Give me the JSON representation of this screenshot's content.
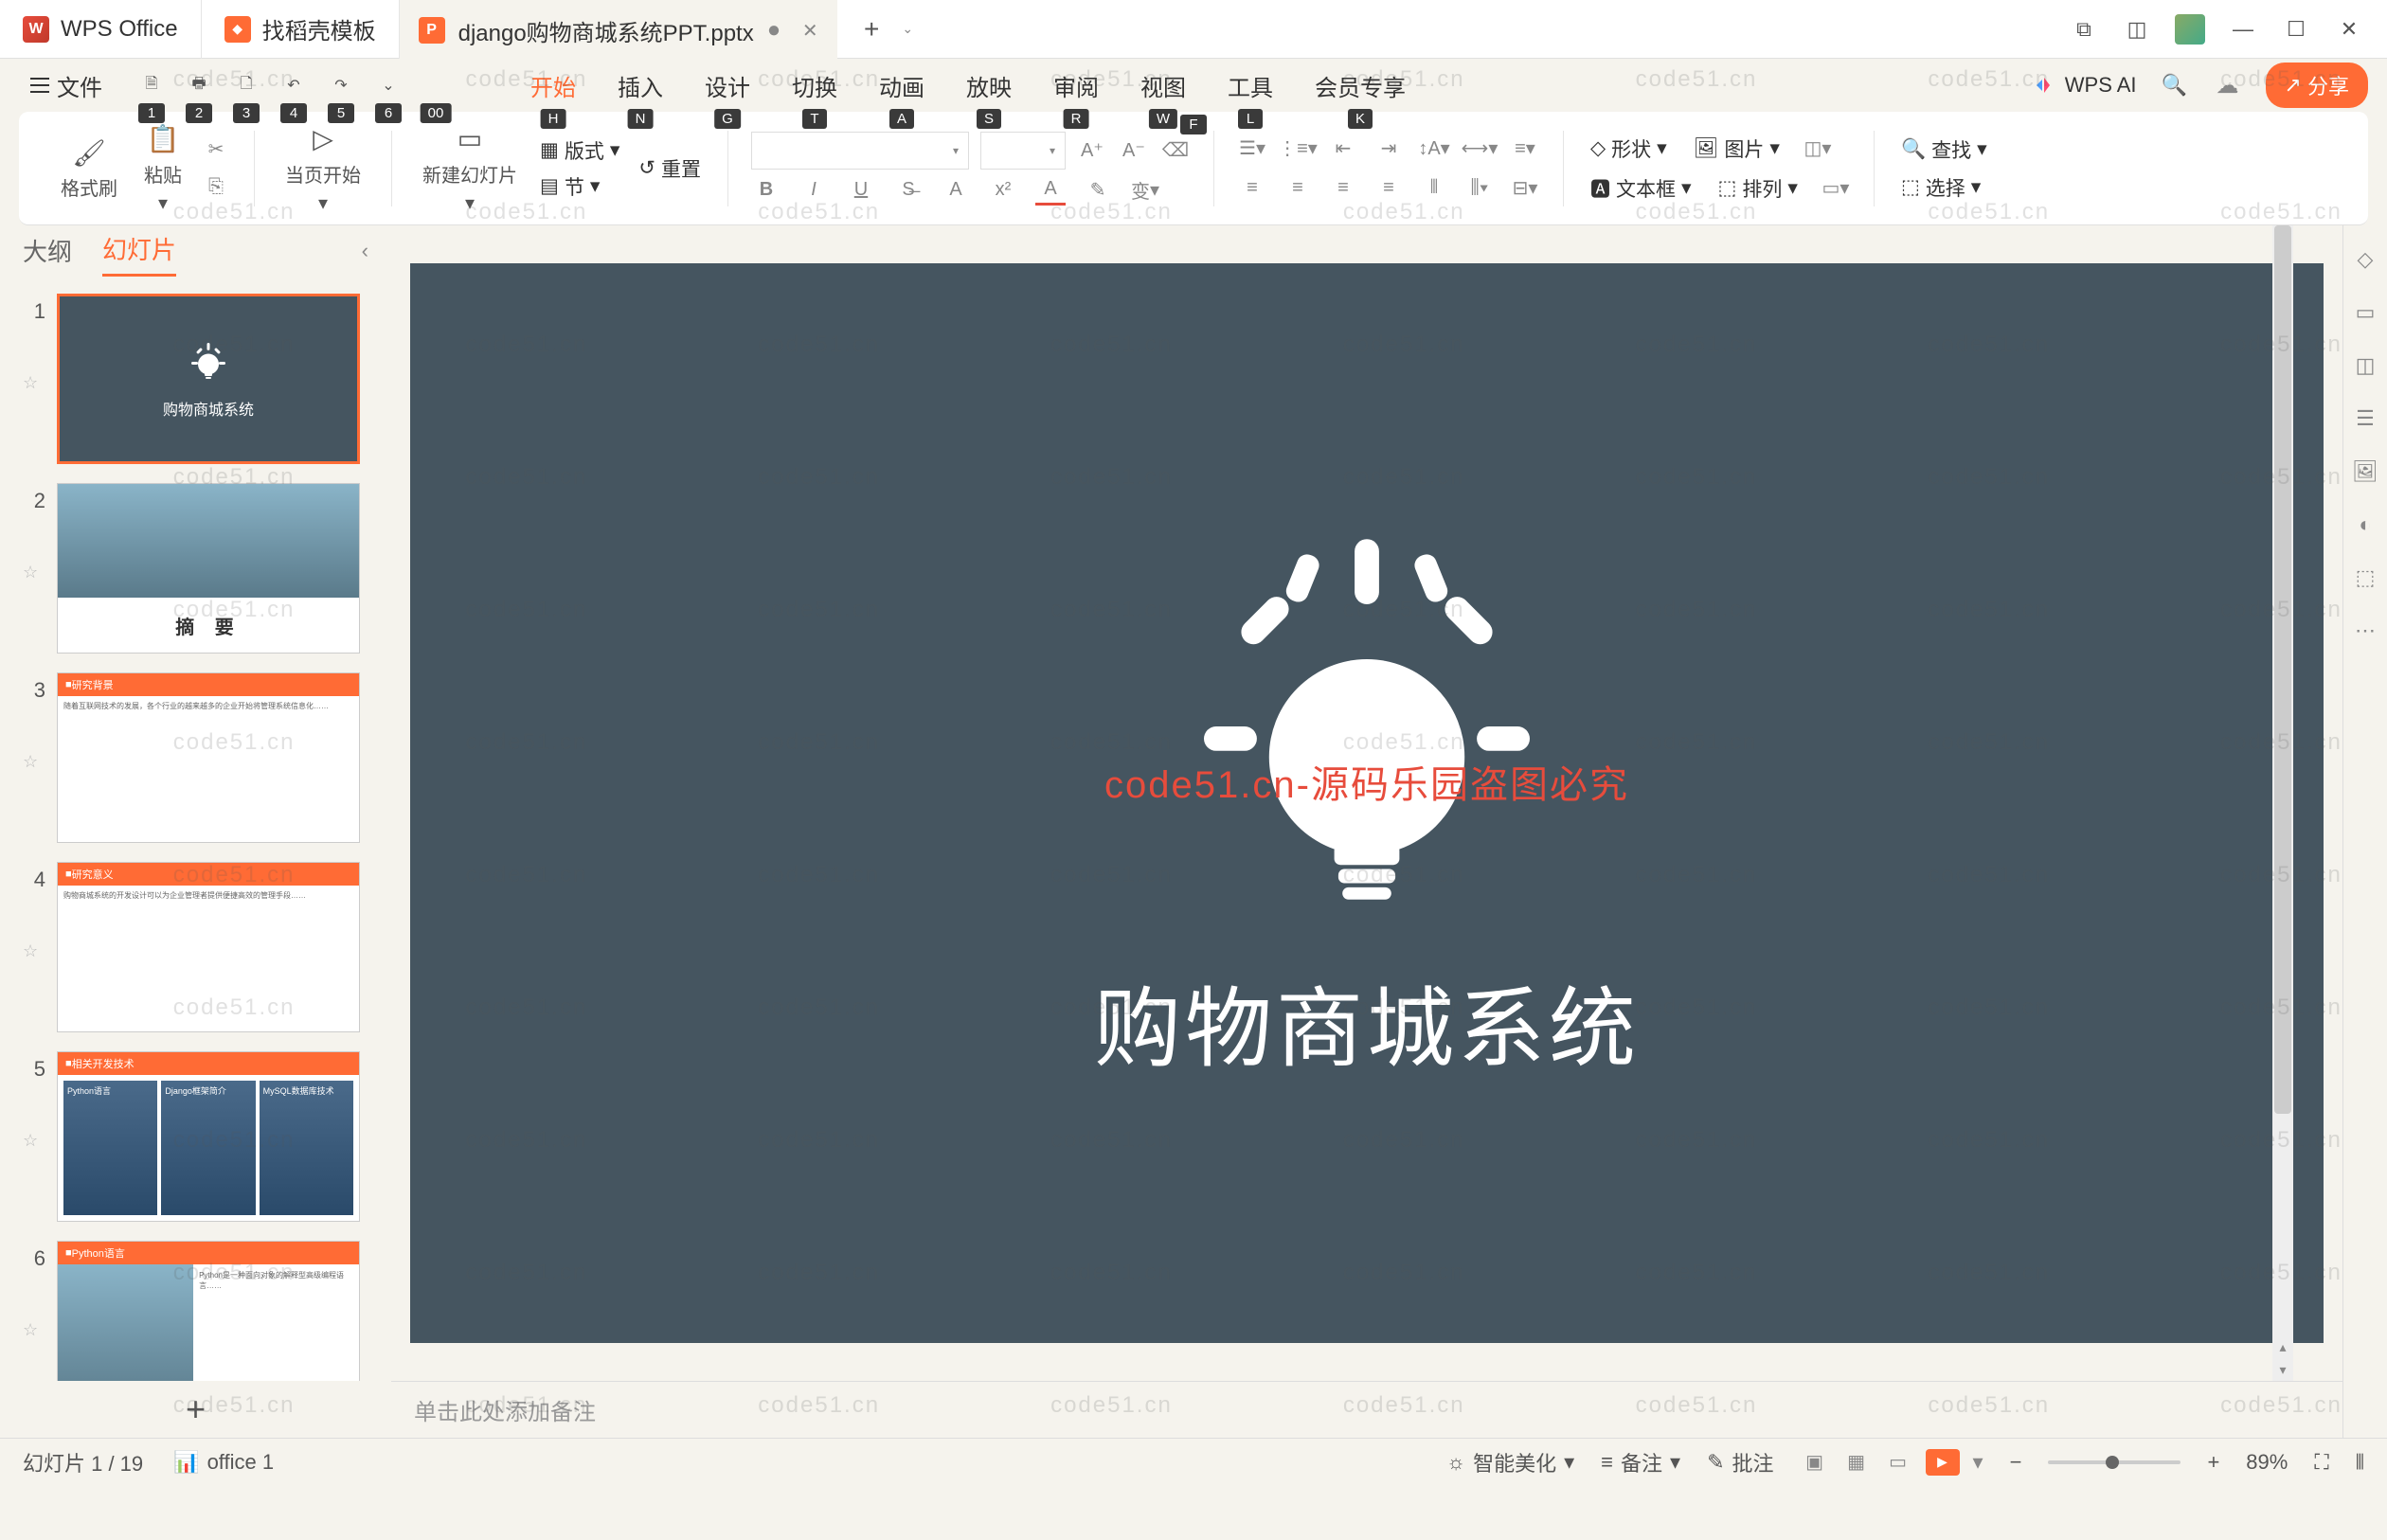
{
  "titlebar": {
    "app_name": "WPS Office",
    "template_tab": "找稻壳模板",
    "file_name": "django购物商城系统PPT.pptx"
  },
  "file_menu": {
    "label": "文件",
    "key": "F"
  },
  "qat_keys": [
    "1",
    "2",
    "3",
    "4",
    "5",
    "6",
    "00"
  ],
  "menu": {
    "tabs": [
      {
        "label": "开始",
        "key": "H",
        "active": true
      },
      {
        "label": "插入",
        "key": "N"
      },
      {
        "label": "设计",
        "key": "G"
      },
      {
        "label": "切换",
        "key": "T"
      },
      {
        "label": "动画",
        "key": "A"
      },
      {
        "label": "放映",
        "key": "S"
      },
      {
        "label": "审阅",
        "key": "R"
      },
      {
        "label": "视图",
        "key": "W"
      },
      {
        "label": "工具",
        "key": "L"
      },
      {
        "label": "会员专享",
        "key": "K"
      }
    ],
    "wps_ai": "WPS AI",
    "share": "分享"
  },
  "ribbon": {
    "format_painter": "格式刷",
    "paste": "粘贴",
    "from_current": "当页开始",
    "new_slide": "新建幻灯片",
    "layout": "版式",
    "section": "节",
    "reset": "重置",
    "shape": "形状",
    "image": "图片",
    "textbox": "文本框",
    "arrange": "排列",
    "find": "查找",
    "select": "选择",
    "convert": "变"
  },
  "sidebar": {
    "outline": "大纲",
    "slides": "幻灯片",
    "thumbs": [
      {
        "n": "1",
        "type": "title",
        "text": "购物商城系统"
      },
      {
        "n": "2",
        "type": "abstract",
        "caption": "摘   要"
      },
      {
        "n": "3",
        "type": "text",
        "hdr": "研究背景"
      },
      {
        "n": "4",
        "type": "text",
        "hdr": "研究意义"
      },
      {
        "n": "5",
        "type": "tech",
        "hdr": "相关开发技术",
        "items": [
          "Python语言",
          "Django框架简介",
          "MySQL数据库技术"
        ]
      },
      {
        "n": "6",
        "type": "split",
        "hdr": "Python语言"
      }
    ]
  },
  "slide": {
    "title": "购物商城系统",
    "watermark_center": "code51.cn-源码乐园盗图必究"
  },
  "notes": {
    "placeholder": "单击此处添加备注"
  },
  "statusbar": {
    "slide_pos": "幻灯片 1 / 19",
    "office": "office 1",
    "beautify": "智能美化",
    "notes": "备注",
    "comments": "批注",
    "zoom": "89%"
  },
  "watermark_text": "code51.cn"
}
